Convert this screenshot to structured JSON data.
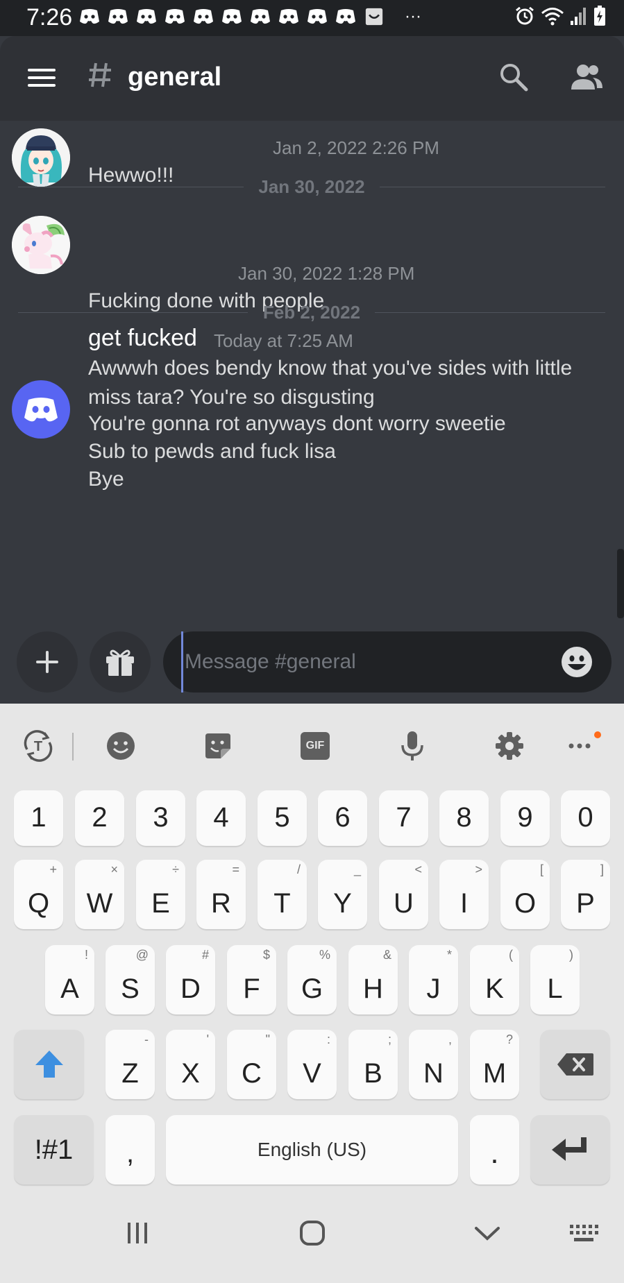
{
  "status_bar": {
    "time": "7:26",
    "notification_icons": [
      "discord-icon",
      "discord-icon",
      "discord-icon",
      "discord-icon",
      "discord-icon",
      "discord-icon",
      "discord-icon",
      "discord-icon",
      "discord-icon",
      "discord-icon",
      "inbox-icon"
    ],
    "more": "···",
    "right_icons": [
      "alarm-icon",
      "wifi-icon",
      "signal-icon",
      "battery-charging-icon"
    ]
  },
  "header": {
    "channel_name": "general",
    "channel_icon": "hash-icon",
    "left_icon": "menu-icon",
    "right_icons": [
      "search-icon",
      "members-icon"
    ]
  },
  "messages": [
    {
      "author": "",
      "avatar": "anime-girl-avatar",
      "timestamp": "Jan 2, 2022 2:26 PM",
      "lines": [
        "Hewwo!!!"
      ]
    },
    {
      "separator": "Jan 30, 2022"
    },
    {
      "author": "",
      "avatar": "sylveon-avatar",
      "timestamp": "Jan 30, 2022 1:28 PM",
      "lines": [
        "Fucking done with people"
      ]
    },
    {
      "separator": "Feb 2, 2022"
    },
    {
      "author": "get fucked",
      "avatar": "discord-default-avatar",
      "timestamp": "Today at 7:25 AM",
      "lines": [
        "Awwwh does bendy know that you've sides with little",
        "miss tara? You're so disgusting",
        "You're gonna rot anyways dont worry sweetie",
        "Sub to pewds and fuck lisa",
        "Bye"
      ]
    }
  ],
  "composer": {
    "placeholder": "Message #general",
    "value": "",
    "buttons": [
      "plus-icon",
      "gift-icon",
      "emoji-icon"
    ]
  },
  "keyboard": {
    "toolbar": [
      "translate-icon",
      "emoji-icon",
      "sticker-icon",
      "gif-icon",
      "microphone-icon",
      "settings-icon",
      "more-icon"
    ],
    "gif_label": "GIF",
    "number_row": [
      "1",
      "2",
      "3",
      "4",
      "5",
      "6",
      "7",
      "8",
      "9",
      "0"
    ],
    "row1": [
      {
        "key": "Q",
        "alt": "+"
      },
      {
        "key": "W",
        "alt": "×"
      },
      {
        "key": "E",
        "alt": "÷"
      },
      {
        "key": "R",
        "alt": "="
      },
      {
        "key": "T",
        "alt": "/"
      },
      {
        "key": "Y",
        "alt": "_"
      },
      {
        "key": "U",
        "alt": "<"
      },
      {
        "key": "I",
        "alt": ">"
      },
      {
        "key": "O",
        "alt": "["
      },
      {
        "key": "P",
        "alt": "]"
      }
    ],
    "row2": [
      {
        "key": "A",
        "alt": "!"
      },
      {
        "key": "S",
        "alt": "@"
      },
      {
        "key": "D",
        "alt": "#"
      },
      {
        "key": "F",
        "alt": "$"
      },
      {
        "key": "G",
        "alt": "%"
      },
      {
        "key": "H",
        "alt": "&"
      },
      {
        "key": "J",
        "alt": "*"
      },
      {
        "key": "K",
        "alt": "("
      },
      {
        "key": "L",
        "alt": ")"
      }
    ],
    "row3": [
      {
        "key": "Z",
        "alt": "-"
      },
      {
        "key": "X",
        "alt": "'"
      },
      {
        "key": "C",
        "alt": "\""
      },
      {
        "key": "V",
        "alt": ":"
      },
      {
        "key": "B",
        "alt": ";"
      },
      {
        "key": "N",
        "alt": ","
      },
      {
        "key": "M",
        "alt": "?"
      }
    ],
    "symbols_label": "!#1",
    "comma": ",",
    "space_label": "English (US)",
    "period": ".",
    "shift_icon": "shift-arrow-icon",
    "backspace_icon": "backspace-icon",
    "enter_icon": "enter-icon"
  },
  "nav_bar": [
    "recent-apps-icon",
    "home-icon",
    "back-chevron-icon",
    "keyboard-switch-icon"
  ],
  "colors": {
    "background": "#36393f",
    "header": "#2f3136",
    "status_bar": "#202225",
    "blurple": "#5865f2",
    "keyboard": "#e6e6e6",
    "shift_blue": "#3d8fe0"
  }
}
